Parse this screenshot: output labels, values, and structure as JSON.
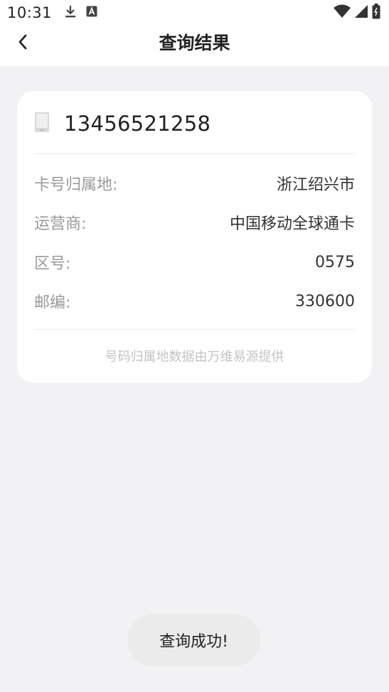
{
  "status_bar": {
    "time": "10:31",
    "left_icons": [
      "download-icon",
      "a-notification-icon"
    ],
    "right_icons": [
      "wifi-icon",
      "signal-icon",
      "battery-icon"
    ]
  },
  "header": {
    "title": "查询结果",
    "back_icon": "chevron-left-icon"
  },
  "result_card": {
    "phone_icon": "mobile-phone-icon",
    "phone_number": "13456521258",
    "rows": [
      {
        "label": "卡号归属地:",
        "value": "浙江绍兴市"
      },
      {
        "label": "运营商:",
        "value": "中国移动全球通卡"
      },
      {
        "label": "区号:",
        "value": "0575"
      },
      {
        "label": "邮编:",
        "value": "330600"
      }
    ],
    "source_note": "号码归属地数据由万维易源提供"
  },
  "toast": {
    "message": "查询成功!"
  },
  "colors": {
    "background": "#f2f2f4",
    "card": "#ffffff",
    "label": "#9a9a9a",
    "value": "#333333",
    "note": "#c4c4c4",
    "toast_bg": "#ebebeb"
  }
}
